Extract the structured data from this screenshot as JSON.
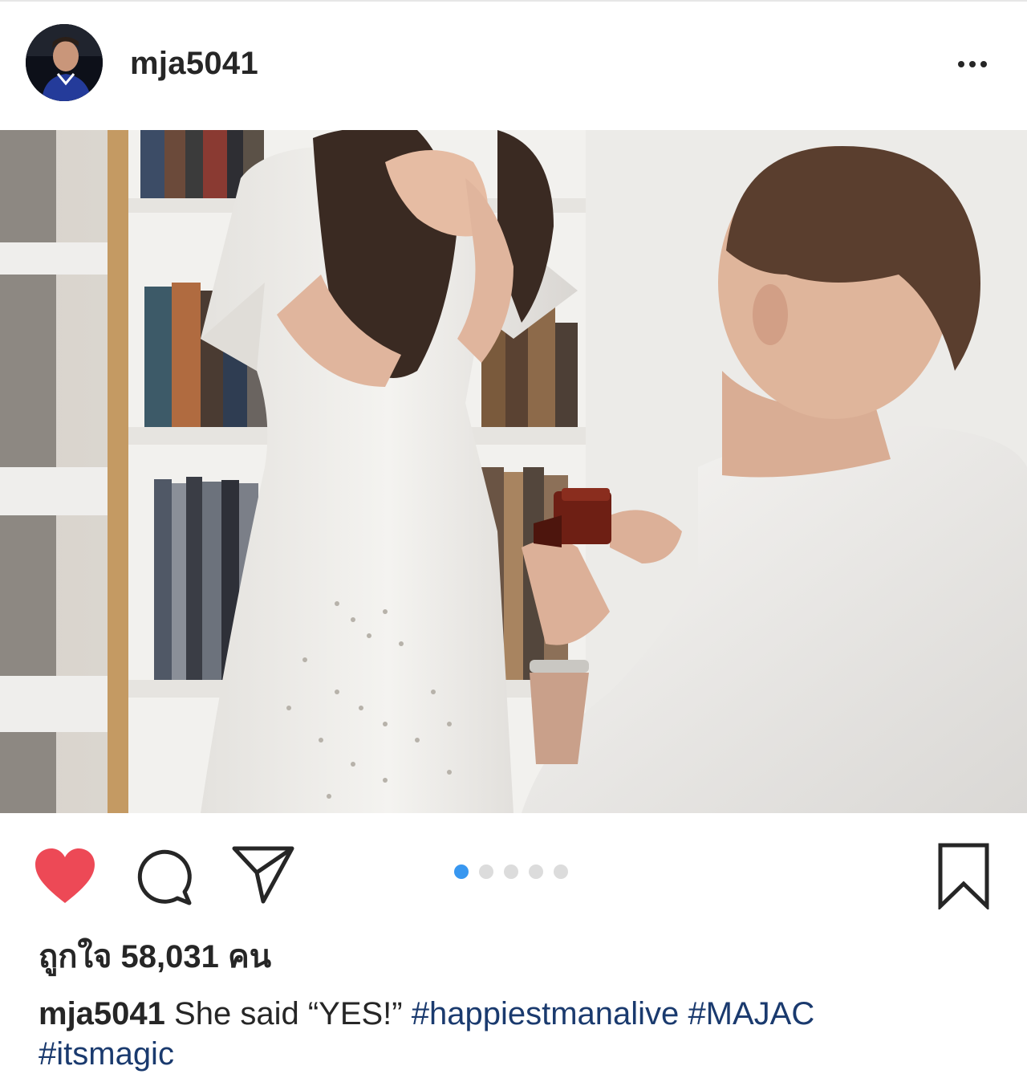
{
  "post": {
    "username": "mja5041",
    "photo_alt": "Man kneeling with an open ring box in front of a woman in a white dress covering her face",
    "carousel": {
      "count": 5,
      "active_index": 0
    },
    "liked": true,
    "likes_text": "ถูกใจ 58,031 คน",
    "caption": {
      "username": "mja5041",
      "text": "She said “YES!”",
      "hashtags": [
        "#happiestmanalive",
        "#MAJAC",
        "#itsmagic"
      ]
    }
  },
  "colors": {
    "like_red": "#ed4956",
    "carousel_active": "#3897f0",
    "carousel_inactive": "#dcdcdc",
    "hashtag": "#1a3a6e",
    "text": "#262626"
  },
  "icons": {
    "more": "more-dots-icon",
    "like": "heart-filled-icon",
    "comment": "comment-bubble-icon",
    "share": "paper-plane-icon",
    "save": "bookmark-icon"
  }
}
